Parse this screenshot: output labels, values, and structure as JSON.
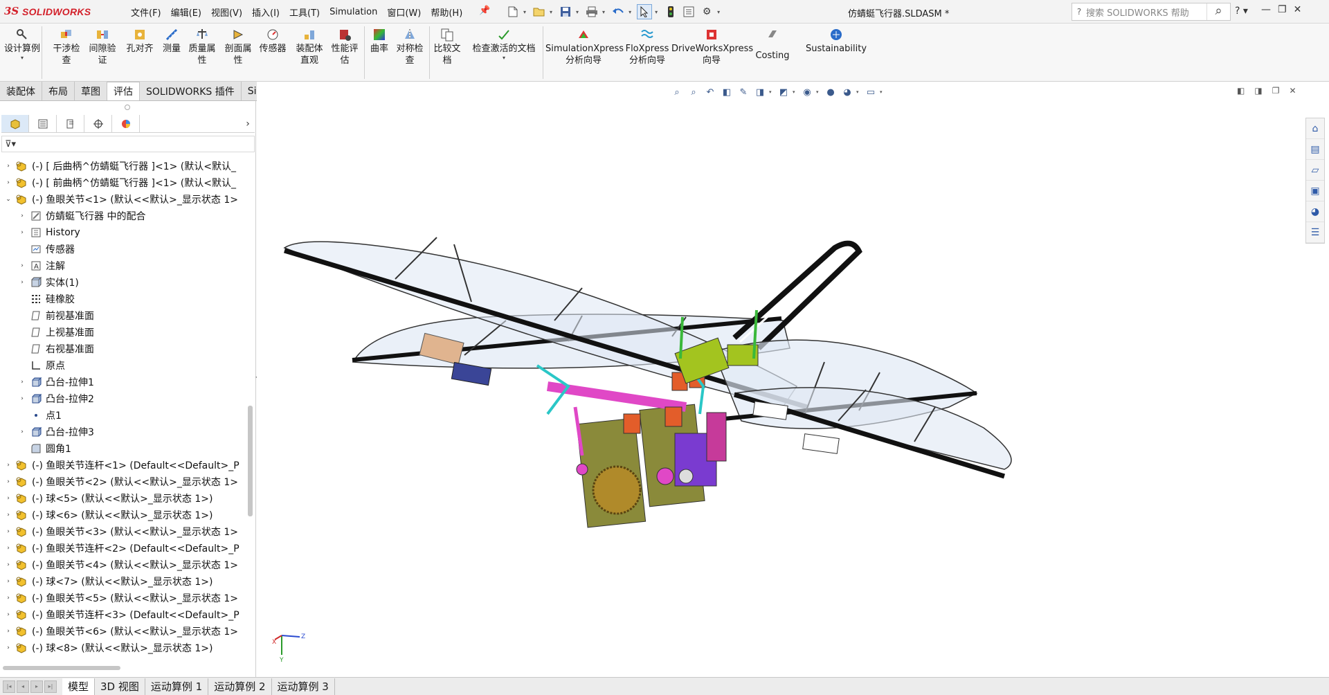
{
  "app": {
    "brand": "SOLIDWORKS",
    "logo_mark": "3S"
  },
  "menus": [
    "文件(F)",
    "编辑(E)",
    "视图(V)",
    "插入(I)",
    "工具(T)",
    "Simulation",
    "窗口(W)",
    "帮助(H)"
  ],
  "document_title": "仿蜻蜓飞行器.SLDASM *",
  "search": {
    "placeholder": "搜索 SOLIDWORKS 帮助"
  },
  "ribbon": {
    "design_study": "设计算例",
    "buttons": [
      {
        "label": "干涉检查",
        "icon": "interference-icon"
      },
      {
        "label": "间隙验证",
        "icon": "clearance-icon"
      },
      {
        "label": "孔对齐",
        "icon": "hole-align-icon"
      },
      {
        "label": "测量",
        "icon": "measure-icon"
      },
      {
        "label": "质量属性",
        "icon": "mass-props-icon"
      },
      {
        "label": "剖面属性",
        "icon": "section-props-icon"
      },
      {
        "label": "传感器",
        "icon": "sensor-icon"
      },
      {
        "label": "装配体直观",
        "icon": "assembly-visual-icon"
      },
      {
        "label": "性能评估",
        "icon": "performance-icon"
      },
      {
        "label": "曲率",
        "icon": "curvature-icon"
      },
      {
        "label": "对称检查",
        "icon": "symmetry-icon"
      },
      {
        "label": "比较文档",
        "icon": "compare-icon"
      },
      {
        "label": "检查激活的文档",
        "icon": "check-doc-icon"
      },
      {
        "label": "SimulationXpress 分析向导",
        "icon": "simxpress-icon"
      },
      {
        "label": "FloXpress 分析向导",
        "icon": "floxpress-icon"
      },
      {
        "label": "DriveWorksXpress 向导",
        "icon": "driveworks-icon"
      },
      {
        "label": "Costing",
        "icon": "costing-icon"
      },
      {
        "label": "Sustainability",
        "icon": "sustainability-icon"
      }
    ]
  },
  "tabs": [
    {
      "label": "装配体",
      "active": false
    },
    {
      "label": "布局",
      "active": false
    },
    {
      "label": "草图",
      "active": false
    },
    {
      "label": "评估",
      "active": true
    },
    {
      "label": "SOLIDWORKS 插件",
      "active": false
    },
    {
      "label": "Simulation",
      "active": false
    }
  ],
  "tree": {
    "items": [
      {
        "label": "(-) [ 后曲柄^仿蜻蜓飞行器 ]<1> (默认<默认_",
        "level": 0,
        "toggle": "›",
        "icon": "part"
      },
      {
        "label": "(-) [ 前曲柄^仿蜻蜓飞行器 ]<1> (默认<默认_",
        "level": 0,
        "toggle": "›",
        "icon": "part"
      },
      {
        "label": "(-) 鱼眼关节<1> (默认<<默认>_显示状态 1>",
        "level": 0,
        "toggle": "⌄",
        "icon": "part"
      },
      {
        "label": "仿蜻蜓飞行器 中的配合",
        "level": 1,
        "toggle": "›",
        "icon": "mates"
      },
      {
        "label": "History",
        "level": 1,
        "toggle": "›",
        "icon": "history"
      },
      {
        "label": "传感器",
        "level": 1,
        "toggle": "",
        "icon": "sensor"
      },
      {
        "label": "注解",
        "level": 1,
        "toggle": "›",
        "icon": "annotation"
      },
      {
        "label": "实体(1)",
        "level": 1,
        "toggle": "›",
        "icon": "solid"
      },
      {
        "label": "硅橡胶",
        "level": 1,
        "toggle": "",
        "icon": "material"
      },
      {
        "label": "前视基准面",
        "level": 1,
        "toggle": "",
        "icon": "plane"
      },
      {
        "label": "上视基准面",
        "level": 1,
        "toggle": "",
        "icon": "plane"
      },
      {
        "label": "右视基准面",
        "level": 1,
        "toggle": "",
        "icon": "plane"
      },
      {
        "label": "原点",
        "level": 1,
        "toggle": "",
        "icon": "origin"
      },
      {
        "label": "凸台-拉伸1",
        "level": 1,
        "toggle": "›",
        "icon": "extrude"
      },
      {
        "label": "凸台-拉伸2",
        "level": 1,
        "toggle": "›",
        "icon": "extrude"
      },
      {
        "label": "点1",
        "level": 1,
        "toggle": "",
        "icon": "point"
      },
      {
        "label": "凸台-拉伸3",
        "level": 1,
        "toggle": "›",
        "icon": "extrude"
      },
      {
        "label": "圆角1",
        "level": 1,
        "toggle": "",
        "icon": "fillet"
      },
      {
        "label": "(-) 鱼眼关节连杆<1> (Default<<Default>_P",
        "level": 0,
        "toggle": "›",
        "icon": "part"
      },
      {
        "label": "(-) 鱼眼关节<2> (默认<<默认>_显示状态 1>",
        "level": 0,
        "toggle": "›",
        "icon": "part"
      },
      {
        "label": "(-) 球<5> (默认<<默认>_显示状态 1>)",
        "level": 0,
        "toggle": "›",
        "icon": "part"
      },
      {
        "label": "(-) 球<6> (默认<<默认>_显示状态 1>)",
        "level": 0,
        "toggle": "›",
        "icon": "part"
      },
      {
        "label": "(-) 鱼眼关节<3> (默认<<默认>_显示状态 1>",
        "level": 0,
        "toggle": "›",
        "icon": "part"
      },
      {
        "label": "(-) 鱼眼关节连杆<2> (Default<<Default>_P",
        "level": 0,
        "toggle": "›",
        "icon": "part"
      },
      {
        "label": "(-) 鱼眼关节<4> (默认<<默认>_显示状态 1>",
        "level": 0,
        "toggle": "›",
        "icon": "part"
      },
      {
        "label": "(-) 球<7> (默认<<默认>_显示状态 1>)",
        "level": 0,
        "toggle": "›",
        "icon": "part"
      },
      {
        "label": "(-) 鱼眼关节<5> (默认<<默认>_显示状态 1>",
        "level": 0,
        "toggle": "›",
        "icon": "part"
      },
      {
        "label": "(-) 鱼眼关节连杆<3> (Default<<Default>_P",
        "level": 0,
        "toggle": "›",
        "icon": "part"
      },
      {
        "label": "(-) 鱼眼关节<6> (默认<<默认>_显示状态 1>",
        "level": 0,
        "toggle": "›",
        "icon": "part"
      },
      {
        "label": "(-) 球<8> (默认<<默认>_显示状态 1>)",
        "level": 0,
        "toggle": "›",
        "icon": "part"
      }
    ]
  },
  "bottom_tabs": [
    {
      "label": "模型",
      "active": true
    },
    {
      "label": "3D 视图",
      "active": false
    },
    {
      "label": "运动算例 1",
      "active": false
    },
    {
      "label": "运动算例 2",
      "active": false
    },
    {
      "label": "运动算例 3",
      "active": false
    }
  ],
  "triad": {
    "x": "X",
    "y": "Y",
    "z": "Z"
  },
  "colors": {
    "brand": "#d3202a",
    "accent": "#2a6cc9",
    "wing_fill": "#dfe8f4",
    "spar": "#111111"
  }
}
